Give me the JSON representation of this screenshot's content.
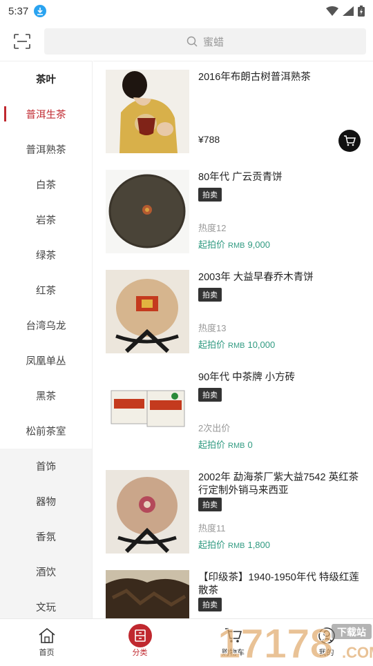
{
  "status_bar": {
    "time": "5:37"
  },
  "search": {
    "placeholder": "蜜蜡"
  },
  "sidebar": {
    "heading": "茶叶",
    "items": [
      {
        "label": "普洱生茶",
        "active": true
      },
      {
        "label": "普洱熟茶"
      },
      {
        "label": "白茶"
      },
      {
        "label": "岩茶"
      },
      {
        "label": "绿茶"
      },
      {
        "label": "红茶"
      },
      {
        "label": "台湾乌龙"
      },
      {
        "label": "凤凰单丛"
      },
      {
        "label": "黑茶"
      },
      {
        "label": "松前茶室"
      },
      {
        "label": "首饰"
      },
      {
        "label": "器物"
      },
      {
        "label": "香氛"
      },
      {
        "label": "酒饮"
      },
      {
        "label": "文玩"
      }
    ]
  },
  "products": [
    {
      "title": "2016年布朗古树普洱熟茶",
      "price": "¥788"
    },
    {
      "title": "80年代 广云贡青饼",
      "tag": "拍卖",
      "heat": "热度12",
      "price_label": "起拍价",
      "currency": "RMB",
      "price": "9,000"
    },
    {
      "title": "2003年 大益早春乔木青饼",
      "tag": "拍卖",
      "heat": "热度13",
      "price_label": "起拍价",
      "currency": "RMB",
      "price": "10,000"
    },
    {
      "title": "90年代 中茶牌 小方砖",
      "tag": "拍卖",
      "heat": "2次出价",
      "price_label": "起拍价",
      "currency": "RMB",
      "price": "0"
    },
    {
      "title": "2002年 勐海茶厂紫大益7542 英红茶行定制外销马来西亚",
      "tag": "拍卖",
      "heat": "热度11",
      "price_label": "起拍价",
      "currency": "RMB",
      "price": "1,800"
    },
    {
      "title": "【印级茶】1940-1950年代 特级红莲散茶",
      "tag": "拍卖"
    }
  ],
  "tabbar": [
    {
      "label": "首页",
      "icon": "home-icon"
    },
    {
      "label": "分类",
      "icon": "category-icon",
      "active": true
    },
    {
      "label": "购物车",
      "icon": "cart-icon"
    },
    {
      "label": "我的",
      "icon": "user-icon"
    }
  ],
  "watermark": {
    "text": "17178",
    "sub": "下载站",
    "domain": ".COM"
  },
  "colors": {
    "accent": "#c0282f",
    "price_green": "#2f9a80"
  }
}
